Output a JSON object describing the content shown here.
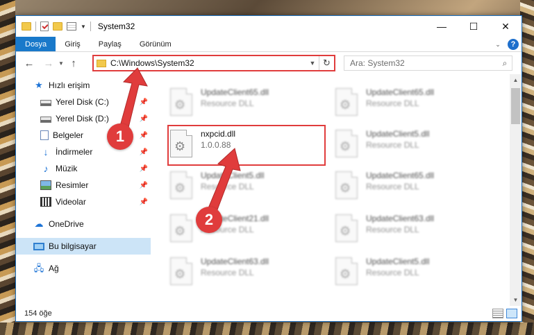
{
  "window": {
    "title": "System32",
    "controls": {
      "minimize": "—",
      "maximize": "☐",
      "close": "✕"
    }
  },
  "ribbon": {
    "tabs": [
      {
        "label": "Dosya",
        "active": true
      },
      {
        "label": "Giriş"
      },
      {
        "label": "Paylaş"
      },
      {
        "label": "Görünüm"
      }
    ],
    "help": "?"
  },
  "address": {
    "path": "C:\\Windows\\System32",
    "search_placeholder": "Ara: System32"
  },
  "sidebar": {
    "items": [
      {
        "label": "Hızlı erişim",
        "icon": "star-icon"
      },
      {
        "label": "Yerel Disk (C:)",
        "icon": "disk-icon",
        "pinned": true
      },
      {
        "label": "Yerel Disk (D:)",
        "icon": "disk-icon",
        "pinned": true
      },
      {
        "label": "Belgeler",
        "icon": "documents-icon",
        "pinned": true
      },
      {
        "label": "İndirmeler",
        "icon": "download-icon",
        "pinned": true
      },
      {
        "label": "Müzik",
        "icon": "music-icon",
        "pinned": true
      },
      {
        "label": "Resimler",
        "icon": "pictures-icon",
        "pinned": true
      },
      {
        "label": "Videolar",
        "icon": "videos-icon",
        "pinned": true
      },
      {
        "label": "OneDrive",
        "icon": "cloud-icon"
      },
      {
        "label": "Bu bilgisayar",
        "icon": "computer-icon",
        "selected": true
      },
      {
        "label": "Ağ",
        "icon": "network-icon"
      }
    ]
  },
  "files": [
    {
      "name": "UpdateClient65.dll",
      "desc": "Resource DLL"
    },
    {
      "name": "UpdateClient65.dll",
      "desc": "Resource DLL"
    },
    {
      "name": "nxpcid.dll",
      "desc": "1.0.0.88"
    },
    {
      "name": "UpdateClient5.dll",
      "desc": "Resource DLL"
    },
    {
      "name": "UpdateClient5.dll",
      "desc": "Resource DLL"
    },
    {
      "name": "UpdateClient65.dll",
      "desc": "Resource DLL"
    },
    {
      "name": "UpdateClient21.dll",
      "desc": "Resource DLL"
    },
    {
      "name": "UpdateClient63.dll",
      "desc": "Resource DLL"
    },
    {
      "name": "UpdateClient63.dll",
      "desc": "Resource DLL"
    },
    {
      "name": "UpdateClient5.dll",
      "desc": "Resource DLL"
    }
  ],
  "status": {
    "count": "154 öğe"
  },
  "annotations": {
    "step1": "1",
    "step2": "2"
  },
  "colors": {
    "accent": "#1979ca",
    "highlight": "#e03c3c"
  }
}
